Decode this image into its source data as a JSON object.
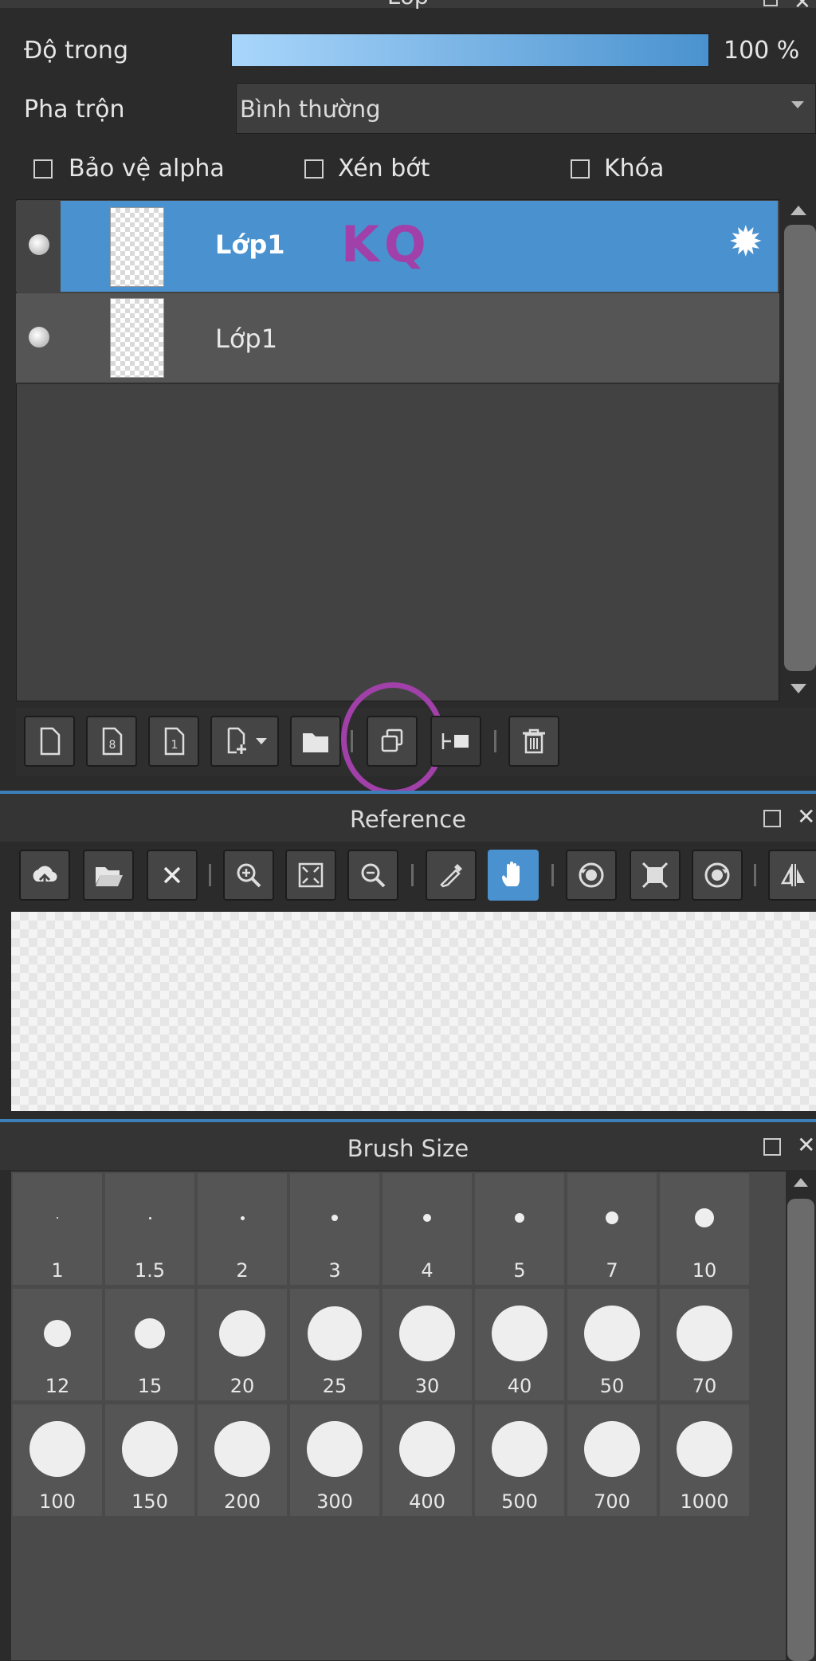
{
  "layer_panel": {
    "title": "Lớp",
    "opacity_label": "Độ trong",
    "opacity_value": "100 %",
    "opacity_fraction": 1.0,
    "blend_label": "Pha trộn",
    "blend_value": "Bình thường",
    "checkboxes": [
      {
        "label": "Bảo vệ alpha",
        "checked": false
      },
      {
        "label": "Xén bớt",
        "checked": false
      },
      {
        "label": "Khóa",
        "checked": false
      }
    ],
    "layers": [
      {
        "name": "Lớp1",
        "selected": true,
        "annotation": "KQ"
      },
      {
        "name": "Lớp1",
        "selected": false
      }
    ]
  },
  "reference_panel": {
    "title": "Reference"
  },
  "brush_panel": {
    "title": "Brush Size",
    "sizes": [
      "1",
      "1.5",
      "2",
      "3",
      "4",
      "5",
      "7",
      "10",
      "12",
      "15",
      "20",
      "25",
      "30",
      "40",
      "50",
      "70",
      "100",
      "150",
      "200",
      "300",
      "400",
      "500",
      "700",
      "1000"
    ]
  },
  "colors": {
    "accent": "#4a92cf",
    "panel_bg": "#2b2b2b",
    "list_bg": "#424242",
    "annotation": "#a040a8"
  }
}
